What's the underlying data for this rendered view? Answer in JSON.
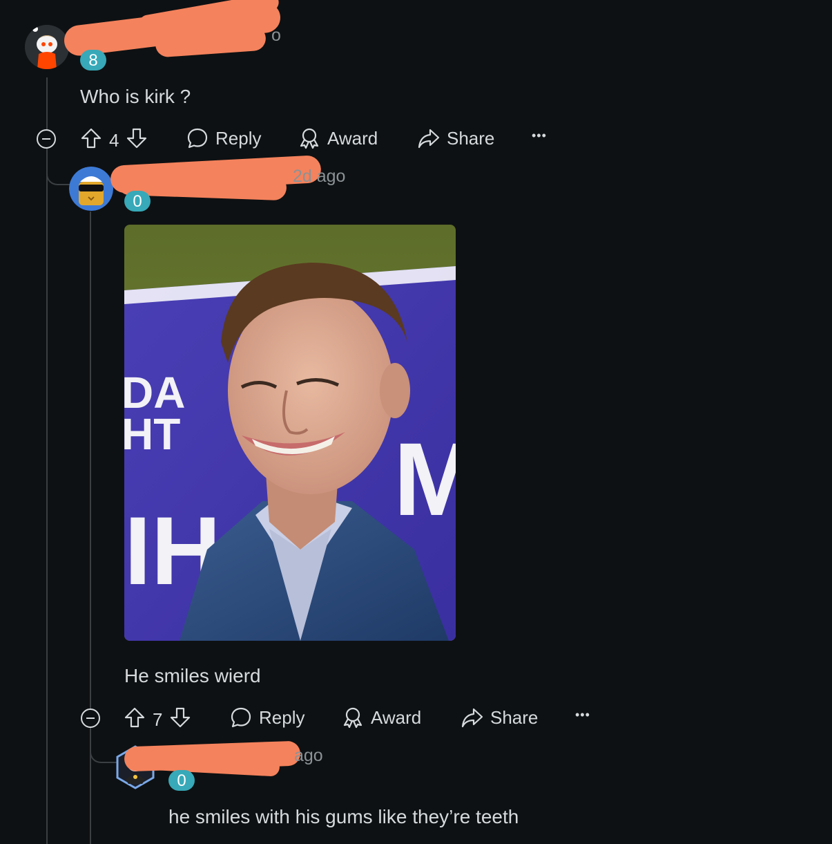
{
  "comments": [
    {
      "timestamp": "o",
      "flair": "8",
      "text": "Who is kirk ?",
      "votes": "4",
      "reply_label": "Reply",
      "award_label": "Award",
      "share_label": "Share",
      "more_label": "•••"
    },
    {
      "timestamp": "2d ago",
      "flair": "0",
      "image_alt": "photo of a smiling man in a blue suit in front of a blue campaign sign",
      "sign_text": [
        "DA",
        "HT",
        "IH",
        "M"
      ],
      "text": "He smiles wierd",
      "votes": "7",
      "reply_label": "Reply",
      "award_label": "Award",
      "share_label": "Share",
      "more_label": "•••"
    },
    {
      "timestamp": "ago",
      "flair": "0",
      "text": "he smiles with his gums like they’re teeth"
    }
  ],
  "icons": {
    "collapse": "collapse-icon",
    "upvote": "upvote-arrow-icon",
    "downvote": "downvote-arrow-icon",
    "reply": "speech-bubble-icon",
    "award": "award-ribbon-icon",
    "share": "share-arrow-icon"
  },
  "colors": {
    "background": "#0e1113",
    "text": "#d7dadc",
    "muted": "#8b9296",
    "flair_badge": "#37a9b8",
    "redaction": "#f4825c",
    "thread_line": "#3a3f42"
  }
}
